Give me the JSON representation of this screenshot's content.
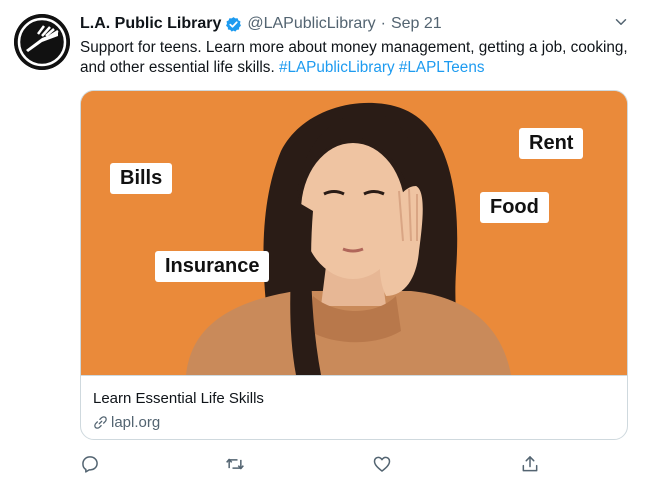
{
  "account": {
    "display_name": "L.A. Public Library",
    "handle": "@LAPublicLibrary",
    "separator": "·",
    "date": "Sep 21",
    "verified": true
  },
  "tweet": {
    "text": "Support for teens. Learn more about money management, getting a job, cooking, and other essential life skills.",
    "hashtags": [
      "#LAPublicLibrary",
      "#LAPLTeens"
    ]
  },
  "card": {
    "image_tags": {
      "bills": "Bills",
      "insurance": "Insurance",
      "rent": "Rent",
      "food": "Food"
    },
    "title": "Learn Essential Life Skills",
    "domain": "lapl.org"
  },
  "actions": {
    "reply_icon": "reply-icon",
    "retweet_icon": "retweet-icon",
    "like_icon": "heart-icon",
    "share_icon": "share-icon"
  },
  "colors": {
    "accent": "#1d9bf0",
    "card_background": "#ea8a3a",
    "text_secondary": "#536471",
    "border": "#cfd9de"
  }
}
